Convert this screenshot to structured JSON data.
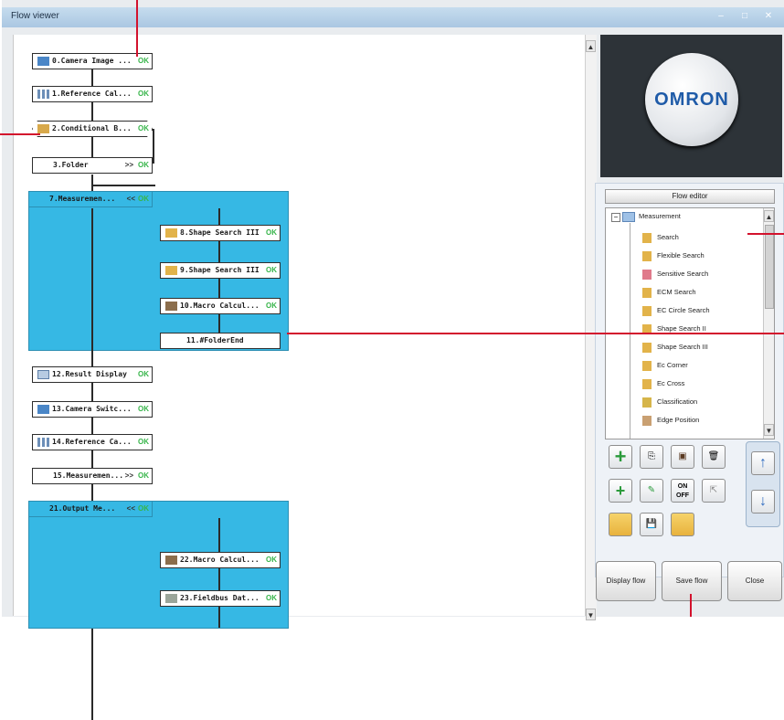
{
  "window": {
    "title": "Flow viewer"
  },
  "flow": [
    {
      "label": "0.Camera Image ...",
      "status": "OK",
      "icon": "camera-image-icon"
    },
    {
      "label": "1.Reference Cal...",
      "status": "OK",
      "icon": "reference-calibration-icon"
    },
    {
      "label": "2.Conditional B...",
      "status": "OK",
      "icon": "conditional-branch-icon"
    },
    {
      "label": "3.Folder",
      "suffix": ">>",
      "status": "OK"
    },
    {
      "label": "7.Measuremen...",
      "suffix": "<<",
      "status": "OK"
    },
    {
      "label": "8.Shape Search III",
      "status": "OK",
      "icon": "shape-search-icon"
    },
    {
      "label": "9.Shape Search III",
      "status": "OK",
      "icon": "shape-search-icon"
    },
    {
      "label": "10.Macro Calcul...",
      "status": "OK",
      "icon": "macro-calc-icon"
    },
    {
      "label": "11.#FolderEnd"
    },
    {
      "label": "12.Result Display",
      "status": "OK",
      "icon": "result-display-icon"
    },
    {
      "label": "13.Camera Switc...",
      "status": "OK",
      "icon": "camera-switch-icon"
    },
    {
      "label": "14.Reference Ca...",
      "status": "OK",
      "icon": "reference-calibration-icon"
    },
    {
      "label": "15.Measuremen...",
      "suffix": ">>",
      "status": "OK"
    },
    {
      "label": "21.Output Me...",
      "suffix": "<<",
      "status": "OK"
    },
    {
      "label": "22.Macro Calcul...",
      "status": "OK",
      "icon": "macro-calc-icon"
    },
    {
      "label": "23.Fieldbus Dat...",
      "status": "OK",
      "icon": "fieldbus-icon"
    }
  ],
  "logo": {
    "text": "OMRON"
  },
  "flow_editor": {
    "header": "Flow editor",
    "root": "Measurement",
    "items": [
      "Search",
      "Flexible Search",
      "Sensitive Search",
      "ECM Search",
      "EC Circle Search",
      "Shape Search II",
      "Shape Search III",
      "Ec Corner",
      "Ec Cross",
      "Classification",
      "Edge Position"
    ],
    "toolbar": [
      "add-icon",
      "copy-icon",
      "paste-icon",
      "delete-icon",
      "insert-icon",
      "rename-icon",
      "on-off-icon",
      "cursor-icon",
      "open-folder-icon",
      "save-icon",
      "link-icon",
      "move-up-icon",
      "move-down-icon"
    ],
    "onoff": {
      "on": "ON",
      "off": "OFF"
    }
  },
  "buttons": {
    "display_flow": "Display flow",
    "save_flow": "Save flow",
    "close": "Close"
  },
  "colors": {
    "accent": "#36b8e4",
    "ok": "#37b54a",
    "annotation": "#d3122d",
    "logo_bg": "#2d3338",
    "brand": "#1f5ba8"
  }
}
